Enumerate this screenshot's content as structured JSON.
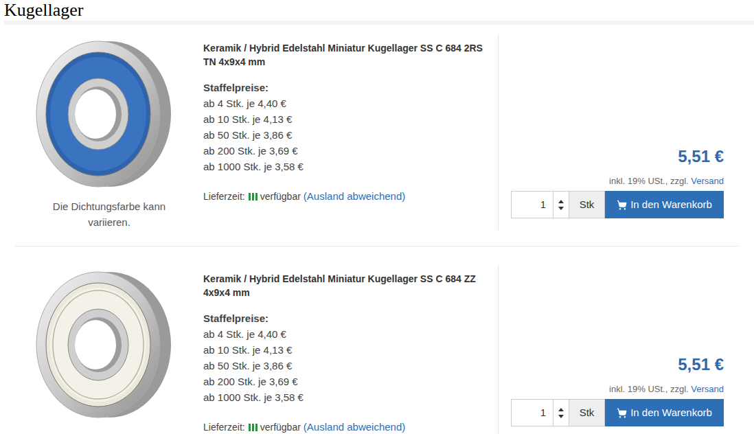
{
  "page": {
    "heading": "Kugellager"
  },
  "products": [
    {
      "title": "Keramik / Hybrid Edelstahl Miniatur Kugellager SS C 684 2RS TN 4x9x4 mm",
      "seal_kind": "rubber",
      "image_caption": "Die Dichtungsfarbe kann variieren.",
      "tiers_label": "Staffelpreise:",
      "tiers": [
        "ab 4 Stk. je 4,40 €",
        "ab 10 Stk. je 4,13 €",
        "ab 50 Stk. je 3,86 €",
        "ab 200 Stk. je 3,69 €",
        "ab 1000 Stk. je 3,58 €"
      ],
      "delivery_label": "Lieferzeit:",
      "availability": "verfügbar",
      "abroad_link": "(Ausland abweichend)",
      "price": "5,51 €",
      "tax_note": "inkl. 19% USt., zzgl.",
      "shipping_link": "Versand",
      "quantity": "1",
      "unit": "Stk",
      "button": "In den Warenkorb"
    },
    {
      "title": "Keramik / Hybrid Edelstahl Miniatur Kugellager SS C 684 ZZ 4x9x4 mm",
      "seal_kind": "metal",
      "image_caption": "",
      "tiers_label": "Staffelpreise:",
      "tiers": [
        "ab 4 Stk. je 4,40 €",
        "ab 10 Stk. je 4,13 €",
        "ab 50 Stk. je 3,86 €",
        "ab 200 Stk. je 3,69 €",
        "ab 1000 Stk. je 3,58 €"
      ],
      "delivery_label": "Lieferzeit:",
      "availability": "verfügbar",
      "abroad_link": "(Ausland abweichend)",
      "price": "5,51 €",
      "tax_note": "inkl. 19% USt., zzgl.",
      "shipping_link": "Versand",
      "quantity": "1",
      "unit": "Stk",
      "button": "In den Warenkorb"
    }
  ]
}
